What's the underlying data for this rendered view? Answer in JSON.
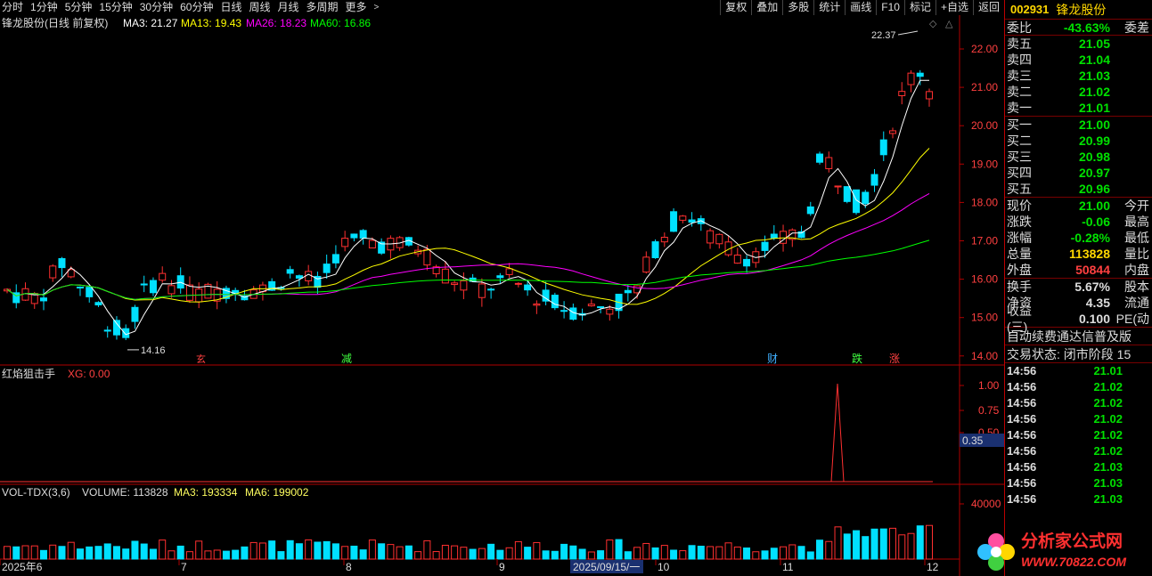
{
  "toolbar": {
    "periods": [
      "分时",
      "1分钟",
      "5分钟",
      "15分钟",
      "30分钟",
      "60分钟",
      "日线",
      "周线",
      "月线",
      "多周期",
      "更多"
    ],
    "more_arrow": ">",
    "actions": [
      "复权",
      "叠加",
      "多股",
      "统计",
      "画线",
      "F10",
      "标记",
      "+自选",
      "返回"
    ]
  },
  "main_chart": {
    "stock_title": "锋龙股份(日线 前复权)",
    "ma3": "MA3: 21.27",
    "ma13": "MA13: 19.43",
    "ma26": "MA26: 18.23",
    "ma60": "MA60: 16.86",
    "y_ticks": [
      "22.00",
      "21.00",
      "20.00",
      "19.00",
      "18.00",
      "17.00",
      "16.00",
      "15.00",
      "14.00"
    ],
    "high_label": "22.37",
    "low_label": "14.16",
    "events": [
      "减",
      "财",
      "跌",
      "涨"
    ],
    "colors": {
      "up": "#ff3030",
      "down": "#00e0ff",
      "ma3": "#ffffff",
      "ma13": "#ffff00",
      "ma26": "#ff00ff",
      "ma60": "#00ff00"
    }
  },
  "indicator": {
    "name": "红焰狙击手",
    "value_label": "XG: 0.00",
    "y_ticks": [
      "1.00",
      "0.75",
      "0.50"
    ],
    "cursor_value": "0.35"
  },
  "volume": {
    "label": "VOL-TDX(3,6)",
    "volume": "VOLUME: 113828",
    "ma3": "MA3: 193334",
    "ma6": "MA6: 199002",
    "y_tick": "40000"
  },
  "x_axis": {
    "labels": [
      "2025年6",
      "7",
      "8",
      "9",
      "10",
      "11",
      "12"
    ],
    "cursor_date": "2025/09/15/一"
  },
  "panel": {
    "code": "002931",
    "name": "锋龙股份",
    "weibi_label": "委比",
    "weibi_value": "-43.63%",
    "weicha_label": "委差",
    "sells": [
      {
        "label": "卖五",
        "price": "21.05"
      },
      {
        "label": "卖四",
        "price": "21.04"
      },
      {
        "label": "卖三",
        "price": "21.03"
      },
      {
        "label": "卖二",
        "price": "21.02"
      },
      {
        "label": "卖一",
        "price": "21.01"
      }
    ],
    "buys": [
      {
        "label": "买一",
        "price": "21.00"
      },
      {
        "label": "买二",
        "price": "20.99"
      },
      {
        "label": "买三",
        "price": "20.98"
      },
      {
        "label": "买四",
        "price": "20.97"
      },
      {
        "label": "买五",
        "price": "20.96"
      }
    ],
    "quote": [
      {
        "label": "现价",
        "value": "21.00",
        "extra": "今开"
      },
      {
        "label": "涨跌",
        "value": "-0.06",
        "extra": "最高"
      },
      {
        "label": "涨幅",
        "value": "-0.28%",
        "extra": "最低"
      },
      {
        "label": "总量",
        "value": "113828",
        "extra": "量比"
      },
      {
        "label": "外盘",
        "value": "50844",
        "extra": "内盘"
      }
    ],
    "quote2": [
      {
        "label": "换手",
        "value": "5.67%",
        "extra": "股本"
      },
      {
        "label": "净资",
        "value": "4.35",
        "extra": "流通"
      },
      {
        "label": "收益(三)",
        "value": "0.100",
        "extra": "PE(动"
      }
    ],
    "notice": "自动续费通达信普及版",
    "status": "交易状态: 闭市阶段 15",
    "ticks": [
      {
        "time": "14:56",
        "price": "21.01"
      },
      {
        "time": "14:56",
        "price": "21.02"
      },
      {
        "time": "14:56",
        "price": "21.02"
      },
      {
        "time": "14:56",
        "price": "21.02"
      },
      {
        "time": "14:56",
        "price": "21.02"
      },
      {
        "time": "14:56",
        "price": "21.02"
      },
      {
        "time": "14:56",
        "price": "21.03"
      },
      {
        "time": "14:56",
        "price": "21.03"
      },
      {
        "time": "14:56",
        "price": "21.03"
      }
    ]
  },
  "watermark": {
    "site_name": "分析家公式网",
    "site_url": "WWW.70822.COM"
  }
}
